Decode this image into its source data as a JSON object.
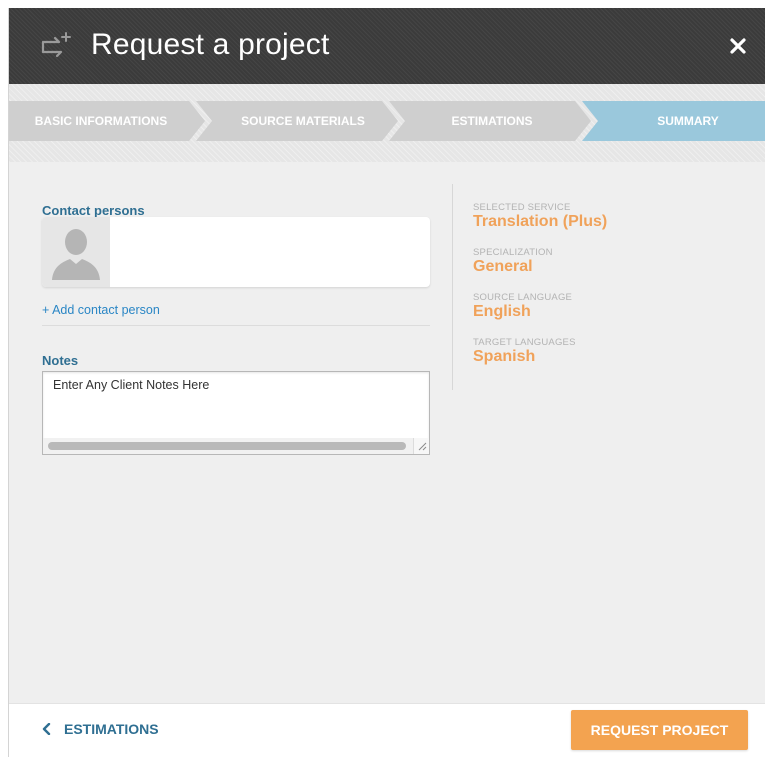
{
  "header": {
    "title": "Request a project",
    "icon": "request-project-icon",
    "close_icon": "close-icon"
  },
  "steps": [
    {
      "label": "BASIC INFORMATIONS",
      "state": "inactive"
    },
    {
      "label": "SOURCE MATERIALS",
      "state": "inactive"
    },
    {
      "label": "ESTIMATIONS",
      "state": "inactive"
    },
    {
      "label": "SUMMARY",
      "state": "active"
    }
  ],
  "contact": {
    "label": "Contact persons",
    "avatar_icon": "person-silhouette-icon",
    "add_link": "+ Add contact person"
  },
  "notes": {
    "label": "Notes",
    "value": "Enter Any Client Notes Here"
  },
  "summary": [
    {
      "label": "SELECTED SERVICE",
      "value": "Translation (Plus)"
    },
    {
      "label": "SPECIALIZATION",
      "value": "General"
    },
    {
      "label": "SOURCE LANGUAGE",
      "value": "English"
    },
    {
      "label": "TARGET LANGUAGES",
      "value": "Spanish"
    }
  ],
  "footer": {
    "back_label": "ESTIMATIONS",
    "back_icon": "chevron-left-icon",
    "submit_label": "REQUEST PROJECT"
  },
  "colors": {
    "header_bg": "#3b3b3b",
    "step_active": "#9ac8dc",
    "step_inactive": "#cfcfcf",
    "section_label": "#2f6f92",
    "link": "#2a86c5",
    "summary_value": "#f0a25a",
    "primary_button": "#f3a350"
  }
}
